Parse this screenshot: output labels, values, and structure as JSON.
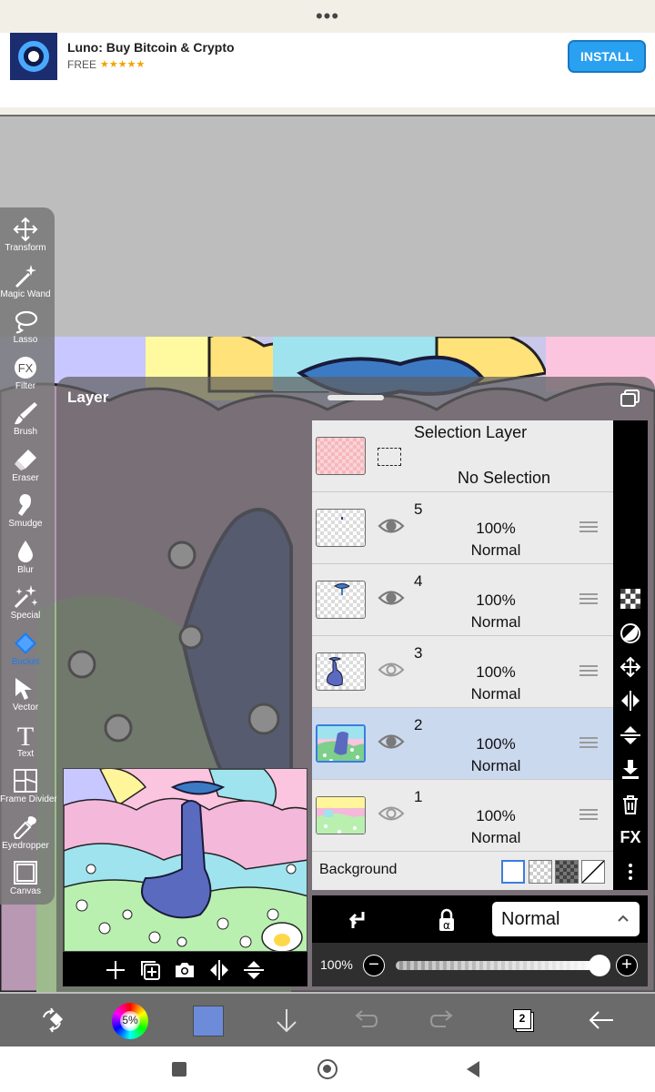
{
  "ad": {
    "more": "•••",
    "app_name": "Luno: Buy Bitcoin & Crypto",
    "price": "FREE",
    "rating_stars": "★★★★★",
    "rating": 4.5,
    "install_label": "INSTALL"
  },
  "tools": [
    {
      "label": "Transform",
      "icon": "move-arrows-icon"
    },
    {
      "label": "Magic Wand",
      "icon": "magic-wand-icon"
    },
    {
      "label": "Lasso",
      "icon": "lasso-icon"
    },
    {
      "label": "Filter",
      "icon": "fx-icon"
    },
    {
      "label": "Brush",
      "icon": "brush-icon"
    },
    {
      "label": "Eraser",
      "icon": "eraser-icon"
    },
    {
      "label": "Smudge",
      "icon": "smudge-icon"
    },
    {
      "label": "Blur",
      "icon": "droplet-icon"
    },
    {
      "label": "Special",
      "icon": "sparkle-icon"
    },
    {
      "label": "Bucket",
      "icon": "bucket-icon",
      "active": true
    },
    {
      "label": "Vector",
      "icon": "cursor-arrow-icon"
    },
    {
      "label": "Text",
      "icon": "text-icon"
    },
    {
      "label": "Frame Divider",
      "icon": "frame-divider-icon"
    },
    {
      "label": "Eyedropper",
      "icon": "eyedropper-icon"
    },
    {
      "label": "Canvas",
      "icon": "canvas-icon"
    }
  ],
  "layer_panel": {
    "title": "Layer",
    "selection_layer": {
      "title": "Selection Layer",
      "status": "No Selection"
    },
    "layers": [
      {
        "number": "5",
        "opacity": "100%",
        "mode": "Normal",
        "visible": true,
        "selected": false
      },
      {
        "number": "4",
        "opacity": "100%",
        "mode": "Normal",
        "visible": true,
        "selected": false
      },
      {
        "number": "3",
        "opacity": "100%",
        "mode": "Normal",
        "visible": false,
        "selected": false
      },
      {
        "number": "2",
        "opacity": "100%",
        "mode": "Normal",
        "visible": true,
        "selected": true
      },
      {
        "number": "1",
        "opacity": "100%",
        "mode": "Normal",
        "visible": false,
        "selected": false
      }
    ],
    "background_label": "Background",
    "blend_mode": "Normal",
    "opacity_label": "100%",
    "opacity_value": 1.0
  },
  "right_tools": [
    "checker-icon",
    "half-circle-icon",
    "move-icon",
    "flip-horizontal-icon",
    "flip-vertical-icon",
    "merge-down-icon",
    "trash-icon",
    "fx-label-icon",
    "more-vertical-icon"
  ],
  "right_tools_fx_text": "FX",
  "bottom_toolbar": {
    "brush_size": "5%",
    "layer_count": "2",
    "current_color": "#6c8bd9"
  },
  "colors": {
    "accent": "#1e7cf0",
    "selected_row": "#cbd9ef",
    "install_button": "#2aa0f0"
  }
}
